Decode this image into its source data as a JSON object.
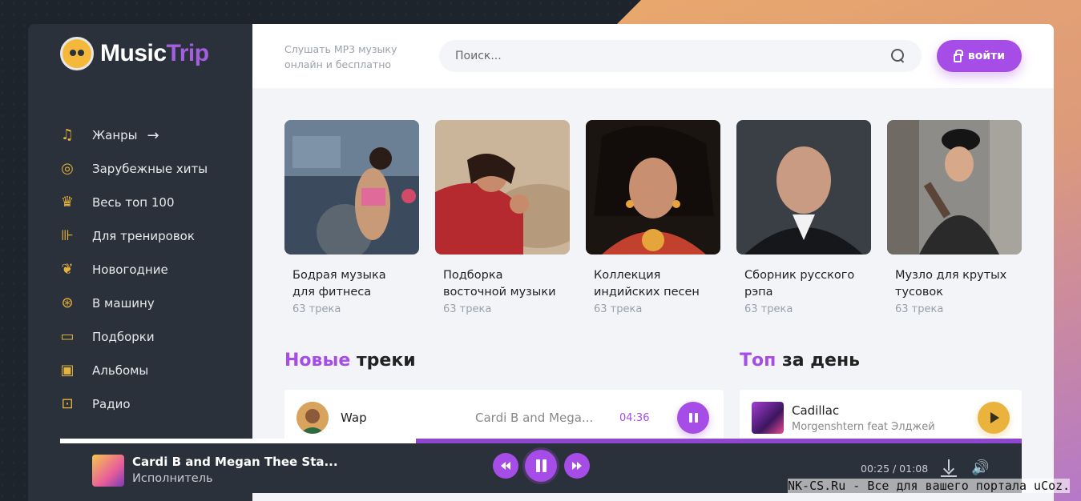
{
  "brand": {
    "name_part1": "Music",
    "name_part2": "Trip"
  },
  "tagline": "Слушать MP3 музыку онлайн и бесплатно",
  "search": {
    "placeholder": "Поиск...",
    "icon": "search-icon"
  },
  "login": {
    "label": "войти",
    "icon": "lock-icon"
  },
  "colors": {
    "accent": "#a54de6",
    "gold": "#e5b23c",
    "sidebar": "#2b313b"
  },
  "sidebar": {
    "items": [
      {
        "label": "Жанры",
        "icon": "genres-icon",
        "arrow": "→"
      },
      {
        "label": "Зарубежные хиты",
        "icon": "disc-icon"
      },
      {
        "label": "Весь топ 100",
        "icon": "trophy-icon"
      },
      {
        "label": "Для тренировок",
        "icon": "dumbbell-icon"
      },
      {
        "label": "Новогодние",
        "icon": "gift-icon"
      },
      {
        "label": "В машину",
        "icon": "wheel-icon"
      },
      {
        "label": "Подборки",
        "icon": "folder-icon"
      },
      {
        "label": "Альбомы",
        "icon": "album-icon"
      },
      {
        "label": "Радио",
        "icon": "radio-icon"
      }
    ]
  },
  "collections": [
    {
      "title": "Бодрая музыка для фитнеса",
      "count": "63 трека"
    },
    {
      "title": "Подборка восточной музыки",
      "count": "63 трека"
    },
    {
      "title": "Коллекция индийских песен",
      "count": "63 трека"
    },
    {
      "title": "Сборник русского рэпа",
      "count": "63 трека"
    },
    {
      "title": "Музло для крутых тусовок",
      "count": "63 трека"
    }
  ],
  "new_tracks": {
    "title_accent": "Новые",
    "title_rest": " треки",
    "items": [
      {
        "title": "Wap",
        "artist": "Cardi B and Mega...",
        "duration": "04:36"
      }
    ]
  },
  "top_day": {
    "title_accent": "Топ",
    "title_rest": " за день",
    "items": [
      {
        "title": "Cadillac",
        "artist": "Morgenshtern feat Элджей"
      }
    ]
  },
  "player": {
    "title": "Cardi B and Megan Thee Sta...",
    "artist": "Исполнитель",
    "time": "00:25 / 01:08",
    "progress": 0.37
  },
  "watermark": "NK-CS.Ru - Все для вашего портала uCoz."
}
